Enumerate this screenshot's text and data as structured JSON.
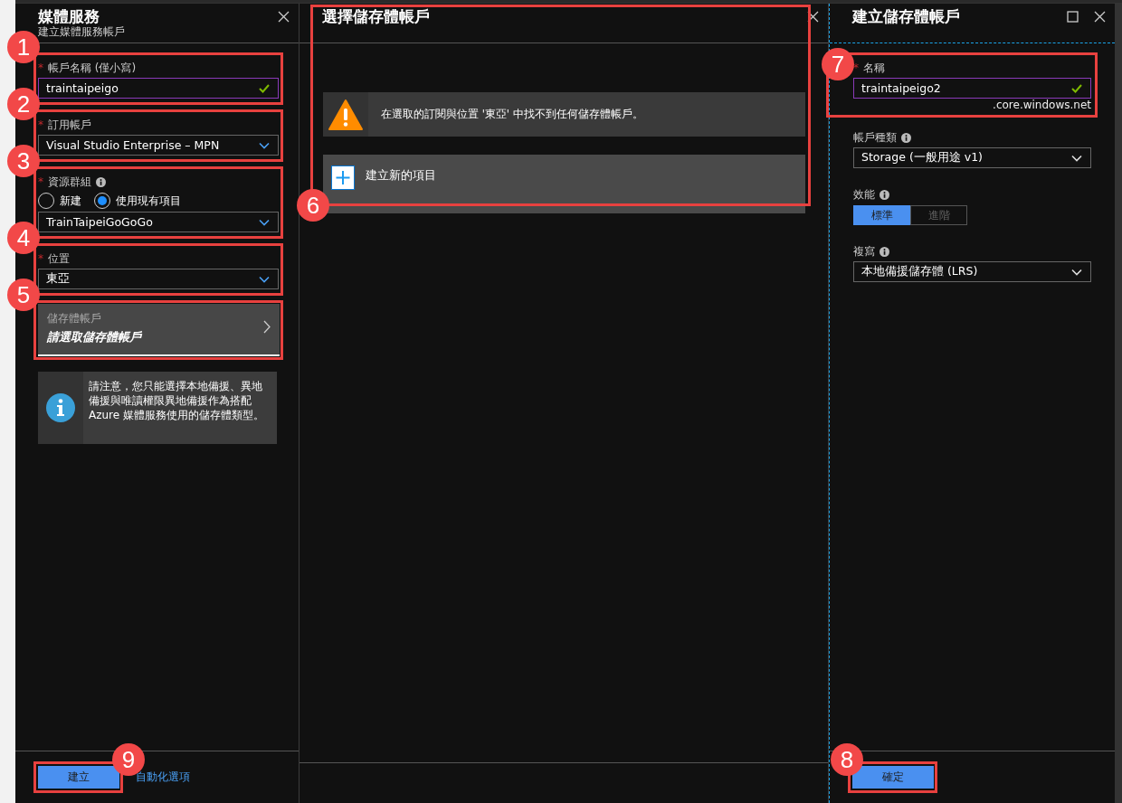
{
  "blades": [
    {
      "kind": "form",
      "title": "媒體服務",
      "subtitle": "建立媒體服務帳戶",
      "active": false,
      "maximizable": false,
      "fields": [
        {
          "kind": "text",
          "required_mark": "*",
          "label": "帳戶名稱 (僅小寫)",
          "info": false,
          "value": "traintaipeigo",
          "valid": true,
          "callout": "1"
        },
        {
          "kind": "dropdown",
          "required_mark": "*",
          "label": "訂用帳戶",
          "info": false,
          "value": "Visual Studio Enterprise – MPN",
          "callout": "2"
        },
        {
          "kind": "radio-dropdown",
          "required_mark": "*",
          "label": "資源群組",
          "info": true,
          "options": [
            {
              "label": "新建",
              "selected": false
            },
            {
              "label": "使用現有項目",
              "selected": true
            }
          ],
          "value": "TrainTaipeiGoGoGo",
          "callout": "3"
        },
        {
          "kind": "dropdown",
          "required_mark": "*",
          "label": "位置",
          "info": false,
          "value": "東亞",
          "callout": "4"
        },
        {
          "kind": "picker",
          "label": "儲存體帳戶",
          "value": "請選取儲存體帳戶",
          "callout": "5"
        }
      ],
      "note": "請注意，您只能選擇本地備援、異地備援與唯讀權限異地備援作為搭配 Azure 媒體服務使用的儲存體類型。",
      "footer": [
        {
          "kind": "primary",
          "label": "建立",
          "callout": "9"
        },
        {
          "kind": "link",
          "label": "自動化選項"
        }
      ]
    },
    {
      "kind": "list",
      "title": "選擇儲存體帳戶",
      "callout": "6",
      "warning": "在選取的訂閱與位置 '東亞' 中找不到任何儲存體帳戶。",
      "create_item": "建立新的項目"
    },
    {
      "kind": "form",
      "title": "建立儲存體帳戶",
      "active": true,
      "maximizable": true,
      "fields": [
        {
          "kind": "text",
          "required_mark": "*",
          "label": "名稱",
          "info": false,
          "value": "traintaipeigo2",
          "valid": true,
          "suffix": ".core.windows.net",
          "callout": "7"
        },
        {
          "kind": "dropdown",
          "label": "帳戶種類",
          "info": true,
          "value": "Storage (一般用途 v1)"
        },
        {
          "kind": "toggle",
          "label": "效能",
          "info": true,
          "options": [
            {
              "label": "標準",
              "selected": true
            },
            {
              "label": "進階",
              "selected": false
            }
          ]
        },
        {
          "kind": "dropdown",
          "label": "複寫",
          "info": true,
          "value": "本地備援儲存體 (LRS)"
        }
      ],
      "footer": [
        {
          "kind": "primary",
          "label": "確定",
          "callout": "8"
        }
      ]
    }
  ]
}
